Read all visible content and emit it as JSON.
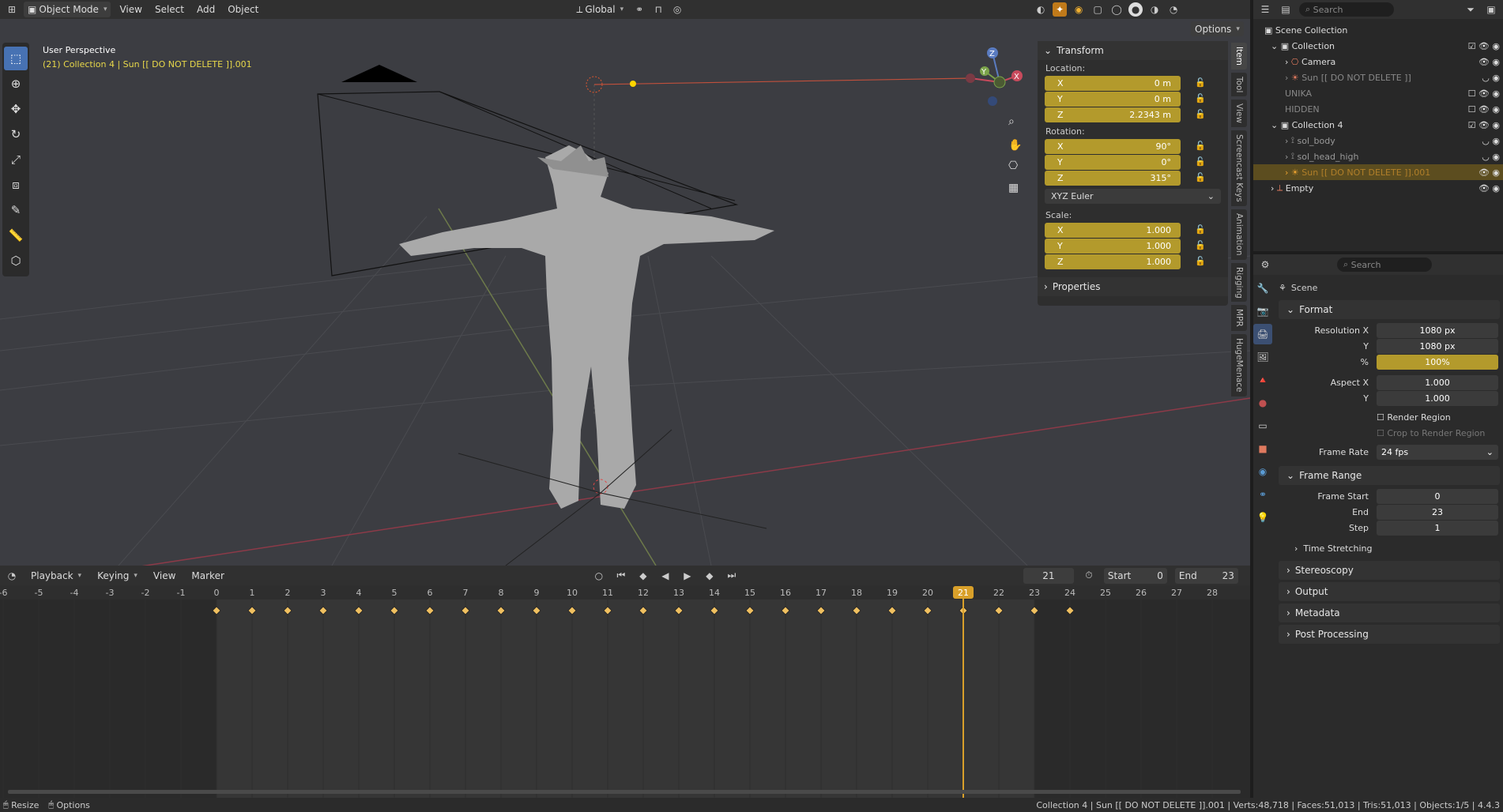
{
  "header": {
    "mode": "Object Mode",
    "menus": [
      "View",
      "Select",
      "Add",
      "Object"
    ],
    "transform_orientation": "Global",
    "search_placeholder": "Search",
    "options_label": "Options"
  },
  "viewport": {
    "perspective_label": "User Perspective",
    "context_label": "(21) Collection 4 | Sun [[ DO NOT DELETE ]].001",
    "gizmo_axes": {
      "x": "X",
      "y": "Y",
      "z": "Z"
    },
    "tools": [
      "select-box",
      "cursor",
      "move",
      "rotate",
      "scale",
      "transform",
      "annotate",
      "measure",
      "add-cube"
    ]
  },
  "npanel": {
    "transform_title": "Transform",
    "location_label": "Location:",
    "location": [
      {
        "axis": "X",
        "value": "0 m"
      },
      {
        "axis": "Y",
        "value": "0 m"
      },
      {
        "axis": "Z",
        "value": "2.2343 m"
      }
    ],
    "rotation_label": "Rotation:",
    "rotation": [
      {
        "axis": "X",
        "value": "90°"
      },
      {
        "axis": "Y",
        "value": "0°"
      },
      {
        "axis": "Z",
        "value": "315°"
      }
    ],
    "rotation_mode": "XYZ Euler",
    "scale_label": "Scale:",
    "scale": [
      {
        "axis": "X",
        "value": "1.000"
      },
      {
        "axis": "Y",
        "value": "1.000"
      },
      {
        "axis": "Z",
        "value": "1.000"
      }
    ],
    "properties_title": "Properties",
    "tabs": [
      "Item",
      "Tool",
      "View",
      "Screencast Keys",
      "Animation",
      "Rigging",
      "MPR",
      "HugeMenace"
    ]
  },
  "outliner": {
    "search_placeholder": "Search",
    "rows": [
      {
        "label": "Scene Collection",
        "indent": 0
      },
      {
        "label": "Collection",
        "indent": 1
      },
      {
        "label": "Camera",
        "indent": 2
      },
      {
        "label": "Sun [[ DO NOT DELETE ]]",
        "indent": 2
      },
      {
        "label": "UNIKA",
        "indent": 1
      },
      {
        "label": "HIDDEN",
        "indent": 1
      },
      {
        "label": "Collection 4",
        "indent": 1
      },
      {
        "label": "sol_body",
        "indent": 2
      },
      {
        "label": "sol_head_high",
        "indent": 2
      },
      {
        "label": "Sun [[ DO NOT DELETE ]].001",
        "indent": 2
      },
      {
        "label": "Empty",
        "indent": 1
      }
    ]
  },
  "properties": {
    "search_placeholder": "Search",
    "scene_label": "Scene",
    "format_title": "Format",
    "resolution_x_label": "Resolution X",
    "resolution_x": "1080 px",
    "resolution_y_label": "Y",
    "resolution_y": "1080 px",
    "percent_label": "%",
    "percent": "100%",
    "aspect_x_label": "Aspect X",
    "aspect_x": "1.000",
    "aspect_y_label": "Y",
    "aspect_y": "1.000",
    "render_region": "Render Region",
    "crop_region": "Crop to Render Region",
    "frame_rate_label": "Frame Rate",
    "frame_rate": "24 fps",
    "frame_range_title": "Frame Range",
    "frame_start_label": "Frame Start",
    "frame_start": "0",
    "end_label": "End",
    "end": "23",
    "step_label": "Step",
    "step": "1",
    "time_stretching": "Time Stretching",
    "sections": [
      "Stereoscopy",
      "Output",
      "Metadata",
      "Post Processing"
    ]
  },
  "timeline": {
    "menus": [
      "Playback",
      "Keying",
      "View",
      "Marker"
    ],
    "current_frame": "21",
    "start_label": "Start",
    "start": "0",
    "end_label": "End",
    "end": "23",
    "ruler": [
      "-6",
      "-5",
      "-4",
      "-3",
      "-2",
      "-1",
      "0",
      "1",
      "2",
      "3",
      "4",
      "5",
      "6",
      "7",
      "8",
      "9",
      "10",
      "11",
      "12",
      "13",
      "14",
      "15",
      "16",
      "17",
      "18",
      "19",
      "20",
      "21",
      "22",
      "23",
      "24",
      "25",
      "26",
      "27",
      "28"
    ],
    "keyframes": [
      0,
      1,
      2,
      3,
      4,
      5,
      6,
      7,
      8,
      9,
      10,
      11,
      12,
      13,
      14,
      15,
      16,
      17,
      18,
      19,
      20,
      21,
      22,
      23,
      24
    ]
  },
  "status": {
    "resize": "Resize",
    "options": "Options",
    "stats": "Collection 4 | Sun [[ DO NOT DELETE ]].001 | Verts:48,718 | Faces:51,013 | Tris:51,013 | Objects:1/5 | 4.4.3"
  },
  "colors": {
    "accent_gold": "#b39a2c",
    "active_blue": "#4772b3",
    "current_frame": "#d9a02a",
    "keyframe": "#f0c060"
  }
}
